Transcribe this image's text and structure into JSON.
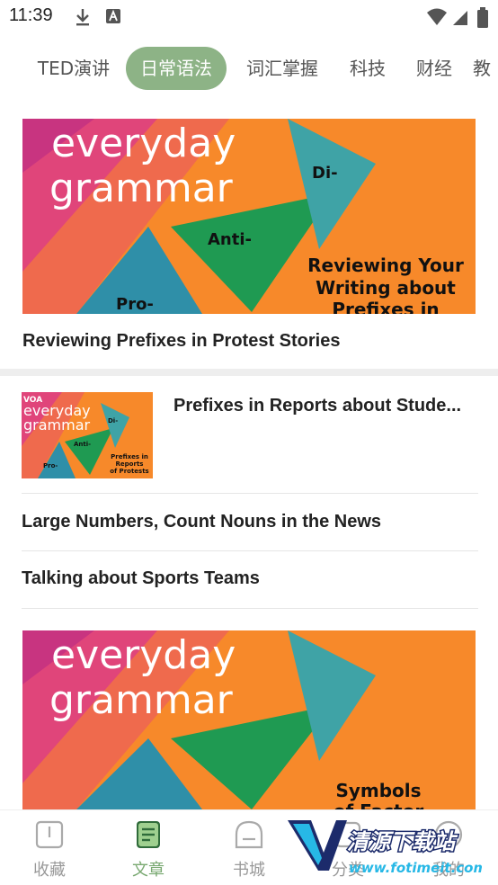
{
  "status_bar": {
    "time": "11:39"
  },
  "tabs": [
    {
      "label": "TED演讲"
    },
    {
      "label": "日常语法"
    },
    {
      "label": "词汇掌握"
    },
    {
      "label": "科技"
    },
    {
      "label": "财经"
    },
    {
      "label": "教"
    }
  ],
  "feature": {
    "image_text": {
      "line1": "everyday",
      "line2": "grammar",
      "tri1": "Di-",
      "tri2": "Anti-",
      "tri3": "Pro-",
      "caption1": "Reviewing Your",
      "caption2": "Writing about",
      "caption3": "Prefixes in"
    },
    "title": "Reviewing Prefixes in Protest Stories"
  },
  "articles": [
    {
      "title": "Prefixes in Reports about Stude...",
      "thumb_text": {
        "brand": "VOA",
        "line1": "everyday",
        "line2": "grammar",
        "tri1": "Di-",
        "tri2": "Anti-",
        "tri3": "Pro-",
        "cap1": "Prefixes in",
        "cap2": "Reports",
        "cap3": "of Protests"
      }
    },
    {
      "title": "Large Numbers, Count Nouns in the News"
    },
    {
      "title": "Talking about Sports Teams"
    }
  ],
  "feature2": {
    "image_text": {
      "line1": "everyday",
      "line2": "grammar",
      "caption1": "Symbols",
      "caption2": "of Factor"
    }
  },
  "bottom_nav": [
    {
      "label": "收藏",
      "icon": "book-icon"
    },
    {
      "label": "文章",
      "icon": "article-icon"
    },
    {
      "label": "书城",
      "icon": "store-icon"
    },
    {
      "label": "分类",
      "icon": "category-icon"
    },
    {
      "label": "我的",
      "icon": "profile-icon"
    }
  ],
  "watermark": {
    "line1": "清源下载站",
    "line2": "www.fotimeit.com"
  },
  "colors": {
    "accent": "#8db386",
    "active_nav": "#7aa972",
    "banner_orange": "#f7892a",
    "banner_green": "#1f9a52",
    "banner_teal": "#3fa3a6",
    "banner_pink": "#e0457a"
  }
}
